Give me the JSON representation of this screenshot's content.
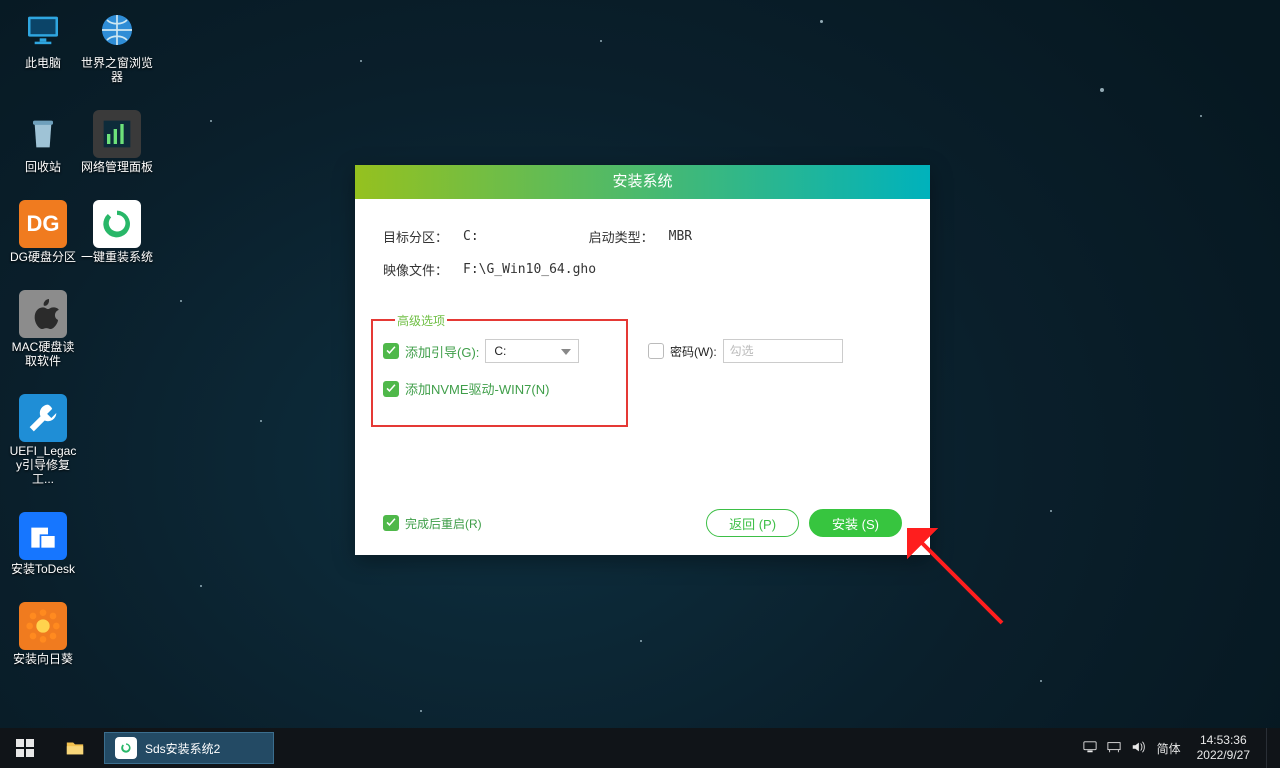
{
  "desktop_icons": [
    {
      "name": "this-pc",
      "label": "此电脑"
    },
    {
      "name": "world-browser",
      "label": "世界之窗浏览器"
    },
    {
      "name": "recycle-bin",
      "label": "回收站"
    },
    {
      "name": "net-mgmt",
      "label": "网络管理面板"
    },
    {
      "name": "dg-disk",
      "label": "DG硬盘分区"
    },
    {
      "name": "oneclick-reinstall",
      "label": "一键重装系统"
    },
    {
      "name": "mac-disk",
      "label": "MAC硬盘读取软件"
    },
    {
      "name": "uefi-legacy",
      "label": "UEFI_Legacy引导修复工..."
    },
    {
      "name": "install-todesk",
      "label": "安装ToDesk"
    },
    {
      "name": "install-sunflower",
      "label": "安装向日葵"
    }
  ],
  "dialog": {
    "title": "安装系统",
    "target_label": "目标分区：",
    "target_value": "C:",
    "boot_label": "启动类型：",
    "boot_value": "MBR",
    "image_label": "映像文件：",
    "image_value": "F:\\G_Win10_64.gho",
    "adv_legend": "高级选项",
    "add_boot_label": "添加引导(G):",
    "add_boot_value": "C:",
    "nvme_label": "添加NVME驱动-WIN7(N)",
    "pwd_label": "密码(W):",
    "pwd_placeholder": "勾选",
    "restart_label": "完成后重启(R)",
    "back_btn": "返回 (P)",
    "install_btn": "安装 (S)"
  },
  "taskbar": {
    "task_label": "Sds安装系统2",
    "ime_label": "简体",
    "time": "14:53:36",
    "date": "2022/9/27"
  }
}
